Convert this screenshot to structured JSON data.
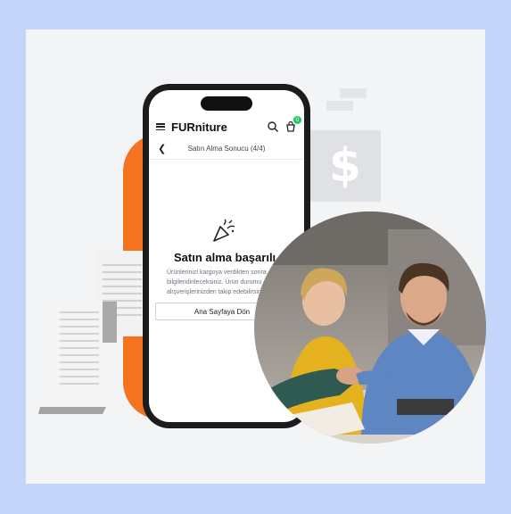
{
  "app": {
    "brand": "FURniture",
    "cart_count": "0"
  },
  "page": {
    "subtitle": "Satın Alma Sonucu (4/4)",
    "success_title": "Satın alma başarılı",
    "message_lines": [
      "Ürünlerinizi kargoya verdikten sonra",
      "bilgilendirileceksiniz. Ürün durumu",
      "alışverişlerinizden takip edebilirsiniz."
    ],
    "home_button": "Ana Sayfaya Dön"
  },
  "decor": {
    "dollar_symbol": "$",
    "icons": [
      "menu-icon",
      "search-icon",
      "cart-icon",
      "back-icon",
      "confetti-icon"
    ]
  },
  "colors": {
    "background": "#c3d6f9",
    "accent_orange": "#f37321",
    "badge_green": "#22c55e"
  }
}
